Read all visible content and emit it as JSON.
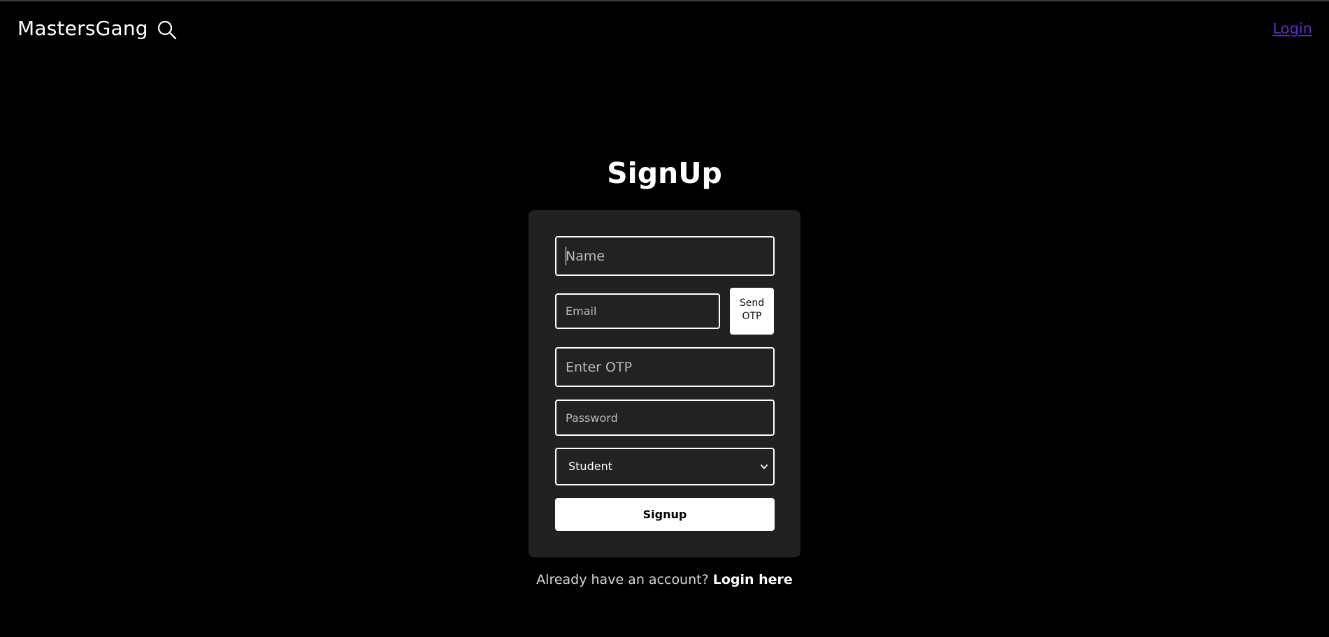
{
  "navbar": {
    "brand": "MastersGang",
    "search_icon": "search-icon",
    "login_link": "Login",
    "login_color": "#5b2fc9"
  },
  "page": {
    "title": "SignUp"
  },
  "form": {
    "name_placeholder": "Name",
    "email_placeholder": "Email",
    "send_otp_line1": "Send",
    "send_otp_line2": "OTP",
    "otp_placeholder": "Enter OTP",
    "password_placeholder": "Password",
    "role_selected": "Student",
    "submit_label": "Signup"
  },
  "footer": {
    "prompt": "Already have an account? ",
    "link": "Login here"
  },
  "colors": {
    "background": "#000000",
    "card": "#212121",
    "input_bg": "#222222",
    "button_bg": "#ffffff"
  }
}
